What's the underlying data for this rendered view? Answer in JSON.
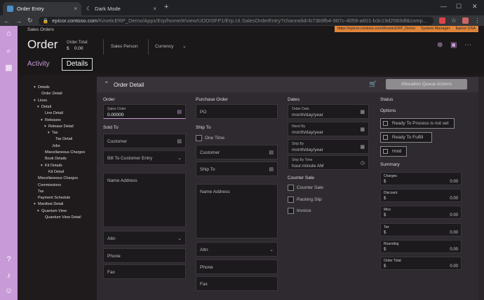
{
  "browser": {
    "tabs": [
      {
        "label": "Order Entry",
        "close": "×"
      },
      {
        "label": "Dark Mode",
        "close": "×"
      }
    ],
    "new_tab": "+",
    "url_host": "epicor.contoso.com",
    "url_path": "/KineticERP_Demo/Apps/Erp/home/#/view/UDDISFP1/Erp.UI.SalesOrderEntry?channelid=b73b9fb4-987c-4059-a601-b3c19d2583df&comp..."
  },
  "app": {
    "breadcrumb": "Sales Orders",
    "env_url": "https://epicor.contoso.com/KineticERP_Demo",
    "env_role": "System Manager",
    "env_company": "Epicor USA",
    "title": "Order",
    "order_total_label": "Order Total",
    "order_total_currency": "$",
    "order_total_value": "0.00",
    "sales_person": "Sales Person",
    "currency": "Currency",
    "tab_activity": "Activity",
    "tab_details": "Details"
  },
  "tree": [
    {
      "label": "Details",
      "indent": 0,
      "arrow": "▾"
    },
    {
      "label": "Order Detail",
      "indent": 1,
      "arrow": ""
    },
    {
      "label": "Lines",
      "indent": 0,
      "arrow": "▾"
    },
    {
      "label": "Detail",
      "indent": 1,
      "arrow": "▾"
    },
    {
      "label": "Line Detail",
      "indent": 2,
      "arrow": ""
    },
    {
      "label": "Releases",
      "indent": 2,
      "arrow": "▾"
    },
    {
      "label": "Release Detail",
      "indent": 3,
      "arrow": "▾"
    },
    {
      "label": "Tax",
      "indent": 4,
      "arrow": "▾"
    },
    {
      "label": "Tax Detail",
      "indent": 5,
      "arrow": ""
    },
    {
      "label": "Jobs",
      "indent": 4,
      "arrow": ""
    },
    {
      "label": "Miscellaneous Charges",
      "indent": 2,
      "arrow": ""
    },
    {
      "label": "Book Details",
      "indent": 2,
      "arrow": ""
    },
    {
      "label": "Kit Details",
      "indent": 2,
      "arrow": "▾"
    },
    {
      "label": "Kit Detail",
      "indent": 3,
      "arrow": ""
    },
    {
      "label": "Miscellaneous Charges",
      "indent": 0,
      "arrow": ""
    },
    {
      "label": "Commissions",
      "indent": 0,
      "arrow": ""
    },
    {
      "label": "Tax",
      "indent": 0,
      "arrow": ""
    },
    {
      "label": "Payment Schedule",
      "indent": 0,
      "arrow": ""
    },
    {
      "label": "Manifest Detail",
      "indent": 0,
      "arrow": "▾"
    },
    {
      "label": "Quantum View",
      "indent": 1,
      "arrow": "▾"
    },
    {
      "label": "Quantum View Detail",
      "indent": 2,
      "arrow": ""
    }
  ],
  "panel": {
    "title": "Order Detail",
    "allocation_button": "Allocation Queue Actions",
    "order_section": "Order",
    "sales_order_label": "Sales Order",
    "sales_order_value": "0.00000",
    "sold_to_section": "Sold To",
    "customer_label": "Customer",
    "bill_to_label": "Bill To Customer Entry",
    "name_address_label": "Name Address",
    "attn_label": "Attn",
    "phone_label": "Phone",
    "fax_label": "Fax",
    "purchase_order_section": "Purchase Order",
    "po_label": "PO",
    "ship_to_section": "Ship To",
    "one_time_label": "One Time",
    "ship_customer_label": "Customer",
    "ship_to_label": "Ship To",
    "ship_name_address_label": "Name Address",
    "ship_attn_label": "Attn",
    "ship_phone_label": "Phone",
    "ship_fax_label": "Fax",
    "dates_section": "Dates",
    "order_date_label": "Order Date",
    "order_date_ph": "month/day/year",
    "need_by_label": "Need By",
    "need_by_ph": "month/day/year",
    "ship_by_label": "Ship By",
    "ship_by_ph": "month/day/year",
    "ship_by_time_label": "Ship By Time",
    "ship_by_time_ph": "hour:minute AM",
    "counter_sale_section": "Counter Sale",
    "counter_sale_label": "Counter Sale",
    "packing_slip_label": "Packing Slip",
    "invoice_label": "Invoice",
    "status_section": "Status",
    "options_section": "Options",
    "ready_process_label": "Ready To Process is not set",
    "ready_fulfill_label": "Ready To Fulfill",
    "hold_label": "Hold",
    "summary_section": "Summary",
    "summary": [
      {
        "label": "Charges",
        "currency": "$",
        "value": "0.00"
      },
      {
        "label": "Discount",
        "currency": "$",
        "value": "0.00"
      },
      {
        "label": "Misc",
        "currency": "$",
        "value": "0.00"
      },
      {
        "label": "Tax",
        "currency": "$",
        "value": "0.00"
      },
      {
        "label": "Rounding",
        "currency": "$",
        "value": "0.00"
      },
      {
        "label": "Order Total",
        "currency": "$",
        "value": "0.00"
      }
    ]
  },
  "colors": {
    "accent": "#c89ad8",
    "env_banner": "#e0853a"
  }
}
